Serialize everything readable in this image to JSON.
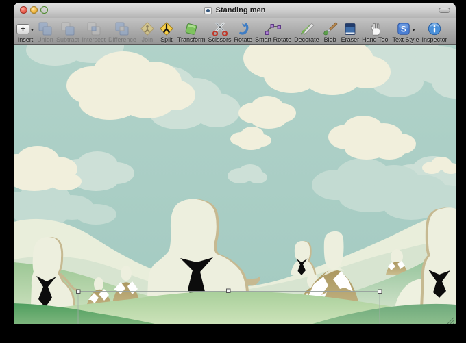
{
  "window": {
    "title": "Standing men",
    "modified_dot": "blue",
    "traffic_lights": [
      "close",
      "minimize",
      "zoom"
    ]
  },
  "toolbar": {
    "items": [
      {
        "label": "Insert",
        "icon": "plus-insert-icon",
        "disabled": false,
        "has_dropdown": true
      },
      {
        "label": "Union",
        "icon": "boolean-union-icon",
        "disabled": true
      },
      {
        "label": "Subtract",
        "icon": "boolean-subtract-icon",
        "disabled": true
      },
      {
        "label": "Intersect",
        "icon": "boolean-intersect-icon",
        "disabled": true
      },
      {
        "label": "Difference",
        "icon": "boolean-difference-icon",
        "disabled": true
      },
      {
        "label": "Join",
        "icon": "join-diamond-icon",
        "disabled": true
      },
      {
        "label": "Split",
        "icon": "split-diamond-icon",
        "disabled": false
      },
      {
        "label": "Transform",
        "icon": "transform-shape-icon",
        "disabled": false
      },
      {
        "label": "Scissors",
        "icon": "scissors-icon",
        "disabled": false
      },
      {
        "label": "Rotate",
        "icon": "rotate-arrow-icon",
        "disabled": false
      },
      {
        "label": "Smart Rotate",
        "icon": "smart-rotate-icon",
        "disabled": false
      },
      {
        "label": "Decorate",
        "icon": "decorate-branch-icon",
        "disabled": false
      },
      {
        "label": "Blob",
        "icon": "paintbrush-icon",
        "disabled": false
      },
      {
        "label": "Eraser",
        "icon": "eraser-icon",
        "disabled": false
      },
      {
        "label": "Hand Tool",
        "icon": "hand-icon",
        "disabled": false
      },
      {
        "label": "Text Style",
        "icon": "text-style-icon",
        "disabled": false,
        "has_dropdown": true
      },
      {
        "label": "Inspector",
        "icon": "inspector-info-icon",
        "disabled": false
      }
    ]
  },
  "palette": {
    "sky": "#a9cec5",
    "cloud_cream": "#f1efdc",
    "cloud_teal": "#cadfd5",
    "man_cream": "#edefde",
    "man_tan_edge": "#c6b991",
    "tie_black": "#0c0c0c",
    "mountain_tan": "#b2a068",
    "snow_white": "#ffffff",
    "hill_pale": "#e9eedb",
    "hill_mid_green": "#8fc295",
    "hill_front_green": "#a8cf9a",
    "hill_dark_green": "#4f9e5f",
    "chrome_gray": "#a6a6a6"
  }
}
